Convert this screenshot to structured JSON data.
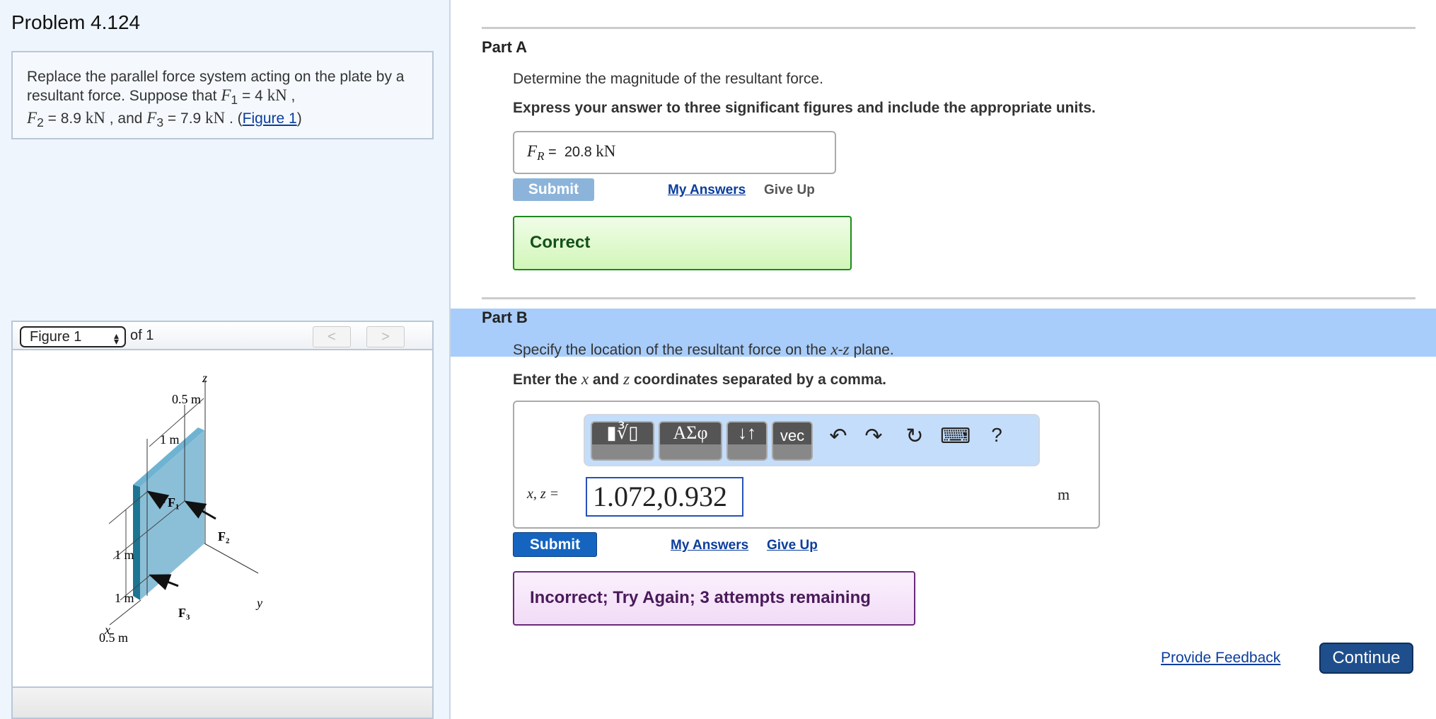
{
  "problem": {
    "title": "Problem 4.124",
    "text_1": "Replace the parallel force system acting on the plate by a resultant force. Suppose that ",
    "F1": "F",
    "F1_sub": "1",
    "eq1": " = 4 ",
    "unit": "kN",
    "sep1": " ,",
    "F2": "F",
    "F2_sub": "2",
    "eq2": " = 8.9 ",
    "and": " , and ",
    "F3": "F",
    "F3_sub": "3",
    "eq3": " = 7.9 ",
    "end": " . (",
    "fig_link": "Figure 1",
    "close": ")"
  },
  "figure": {
    "selector": "Figure 1",
    "of": "of 1",
    "prev": "<",
    "next": ">",
    "labels": {
      "z": "z",
      "y": "y",
      "x": "x",
      "d1": "0.5 m",
      "d2": "1 m",
      "d3": "1 m",
      "d4": "1 m",
      "d5": "0.5 m",
      "F1": "F₁",
      "F2": "F₂",
      "F3": "F₃"
    }
  },
  "partA": {
    "label": "Part A",
    "question": "Determine the magnitude of the resultant force.",
    "instruction": "Express your answer to three significant figures and include the appropriate units.",
    "var": "F",
    "var_sub": "R",
    "eq": " = ",
    "answer": "20.8 ",
    "answer_unit": "kN",
    "submit": "Submit",
    "my_answers": "My Answers",
    "give_up": "Give Up",
    "feedback": "Correct"
  },
  "partB": {
    "label": "Part B",
    "question_1": "Specify the location of the resultant force on the ",
    "question_x": "x",
    "question_dash": "-",
    "question_z": "z",
    "question_2": " plane.",
    "instr_1": "Enter the ",
    "instr_x": "x",
    "instr_2": " and ",
    "instr_z": "z",
    "instr_3": " coordinates separated by a comma.",
    "toolbar": {
      "templates": "▮∛▯",
      "greek": "ΑΣφ",
      "arrows": "↓↑",
      "vec": "vec",
      "undo": "↶",
      "redo": "↷",
      "reset": "↻",
      "keyboard": "⌨",
      "help": "?"
    },
    "var_label": "x, z =",
    "answer": "1.072,0.932",
    "unit": "m",
    "submit": "Submit",
    "my_answers": "My Answers",
    "give_up": "Give Up",
    "feedback": "Incorrect; Try Again; 3 attempts remaining"
  },
  "footer": {
    "feedback": "Provide Feedback",
    "continue": "Continue"
  },
  "colors": {
    "correct_bg": "#d9f7c4",
    "correct_border": "#1e8a1e",
    "incorrect_bg": "#f6e3fa",
    "incorrect_border": "#6b2a7a",
    "submit": "#1565c0",
    "continue": "#1f4e8c"
  }
}
